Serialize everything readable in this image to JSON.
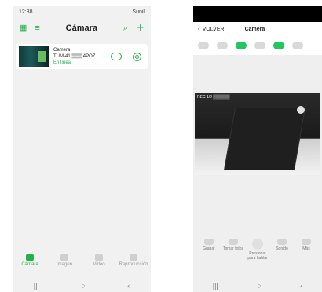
{
  "left": {
    "status": {
      "time": "12:38",
      "right": "Sunil"
    },
    "appbar": {
      "title": "Cámara"
    },
    "camera_card": {
      "name": "Camera",
      "id": "TUM-41 ▒▒▒ 4POZ",
      "state": "En línea"
    },
    "tabs": [
      {
        "label": "Cámara",
        "active": true
      },
      {
        "label": "Imagen",
        "active": false
      },
      {
        "label": "Video",
        "active": false
      },
      {
        "label": "Reproducción",
        "active": false
      }
    ],
    "nav": {
      "recent": "|||",
      "home": "○",
      "back": "‹"
    }
  },
  "right": {
    "appbar": {
      "back_label": "VOLVER",
      "title": "Camera"
    },
    "video_label": "REC 1/2 ▒▒▒▒▒▒",
    "actions": [
      {
        "label": "Grabar"
      },
      {
        "label": "Tomar fotos"
      },
      {
        "label": "Presionar para hablar"
      },
      {
        "label": "Sonido"
      },
      {
        "label": "Más"
      }
    ],
    "nav": {
      "recent": "|||",
      "home": "○",
      "back": "‹"
    }
  }
}
